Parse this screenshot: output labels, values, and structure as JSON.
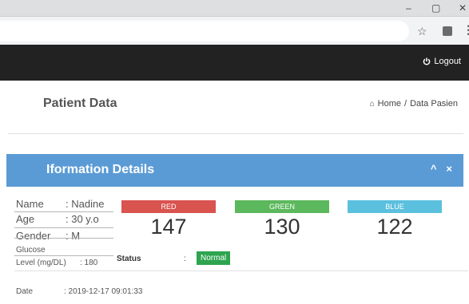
{
  "window": {
    "minimize": "–",
    "maximize": "▢",
    "close": "✕"
  },
  "toolbar": {
    "star": "☆",
    "menu": "⋮"
  },
  "navbar": {
    "logout_label": "Logout"
  },
  "header": {
    "title": "Patient Data",
    "breadcrumb": {
      "home": "Home",
      "separator": "/",
      "current": "Data Pasien"
    }
  },
  "panel": {
    "title": "Iformation Details",
    "collapse": "^",
    "close": "×"
  },
  "patient": {
    "name_label": "Name",
    "name_value": ": Nadine",
    "age_label": "Age",
    "age_value": ": 30 y.o",
    "gender_label": "Gender",
    "gender_value": ": M",
    "glucose_label_1": "Glucose",
    "glucose_label_2": "Level (mg/DL)",
    "glucose_value": ": 180",
    "date_label": "Date",
    "date_value": ": 2019-12-17 09:01:33"
  },
  "color_readings": [
    {
      "label": "RED",
      "value": "147",
      "color": "#d9534f"
    },
    {
      "label": "GREEN",
      "value": "130",
      "color": "#5cb85c"
    },
    {
      "label": "BLUE",
      "value": "122",
      "color": "#5bc0de"
    }
  ],
  "status": {
    "label": "Status",
    "colon": ":",
    "value": "Normal",
    "color": "#2ea44f"
  }
}
